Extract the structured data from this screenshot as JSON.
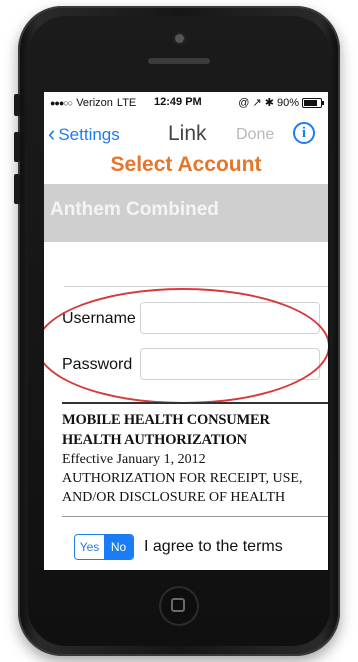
{
  "status_bar": {
    "signal": "●●●○○",
    "carrier": "Verizon",
    "network": "LTE",
    "time": "12:49 PM",
    "indicators": "@ ↗ ✱",
    "battery_percent": "90%"
  },
  "nav": {
    "back_label": "Settings",
    "title": "Link",
    "done_label": "Done",
    "info_icon": "i"
  },
  "page": {
    "heading": "Select Account",
    "selected_account": "Anthem Combined"
  },
  "form": {
    "username_label": "Username",
    "username_value": "",
    "password_label": "Password",
    "password_value": ""
  },
  "terms": {
    "heading_line1": "MOBILE HEALTH CONSUMER",
    "heading_line2": "HEALTH AUTHORIZATION",
    "effective": "Effective January 1, 2012",
    "body_line1": "AUTHORIZATION FOR RECEIPT, USE,",
    "body_line2": "AND/OR DISCLOSURE OF HEALTH"
  },
  "agreement": {
    "yes_label": "Yes",
    "no_label": "No",
    "selected": "No",
    "label": "I agree to the terms"
  },
  "colors": {
    "ios_blue": "#1b7cf3",
    "heading_orange": "#e6762a",
    "account_bar_gray": "#cfcfcf",
    "annotation_red": "#d83a3a"
  }
}
